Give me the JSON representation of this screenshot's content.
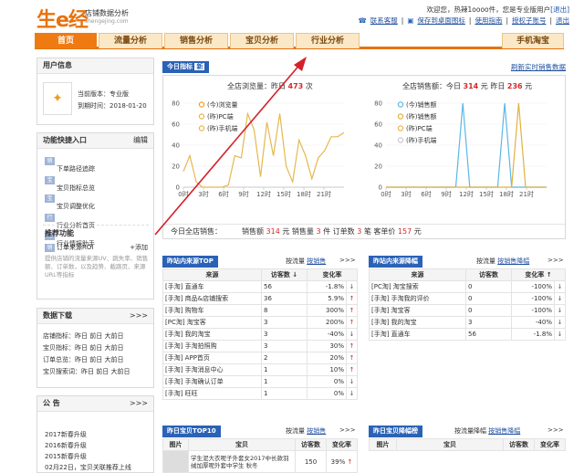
{
  "header": {
    "logo_main": "生e经",
    "logo_sub": "店铺数据分析",
    "logo_url": "shengejing.com",
    "greeting": "欢迎您，热辣1oooo件，您是专业版用户",
    "logout": "[退出]",
    "links": [
      "联系客服",
      "保存到桌面图标",
      "使用指南",
      "授权子账号",
      "退出"
    ]
  },
  "nav": {
    "tabs": [
      "首页",
      "流量分析",
      "销售分析",
      "宝贝分析",
      "行业分析",
      "手机淘宝"
    ]
  },
  "user_info": {
    "title": "用户信息",
    "version": "当前版本：专业版",
    "expire": "到期时间：2018-01-20"
  },
  "quick": {
    "title": "功能快捷入口",
    "edit": "编辑",
    "items": [
      {
        "tag": "销售",
        "label": "下单路径追踪"
      },
      {
        "tag": "宝贝",
        "label": "宝贝指标总览"
      },
      {
        "tag": "宝贝",
        "label": "宝贝调整优化"
      },
      {
        "tag": "行业",
        "label": "行业分析首页"
      },
      {
        "tag": "行业",
        "label": "行业情报助手"
      }
    ],
    "rec_title": "推荐功能",
    "rec_item": "订单来源ROI",
    "rec_add": "+添加",
    "rec_desc": "提供店铺的流量来源UV、跳失率、销售额、订单数，以及趋势、截路页、来源URL等指标"
  },
  "download": {
    "title": "数据下载",
    "more": ">>>",
    "rows": [
      "店铺指标：昨日 前日 大前日",
      "宝贝指标：昨日 前日 大前日",
      "订单总览：昨日 前日 大前日",
      "宝贝搜索词：昨日 前日 大前日"
    ]
  },
  "notice": {
    "title": "公 告",
    "more": ">>>",
    "items": [
      "2017新春升级",
      "2016新春升级",
      "2015新春升级",
      "02月22日，宝贝关联推荐上线"
    ]
  },
  "today": {
    "tag": "今日指标",
    "tag2": "新",
    "refresh": "刷新实时销售数据",
    "traffic_label": "全店浏览量：昨日",
    "traffic_val": "473",
    "traffic_unit": "次",
    "sales_label": "全店销售额：今日",
    "sales_today": "314",
    "sales_mid": "元  昨日",
    "sales_y": "236",
    "sales_unit": "元",
    "footer": {
      "label": "今日全店销售：",
      "items": [
        "销售额 ",
        "314",
        " 元  销售量 ",
        "3",
        " 件  订单数 ",
        "3",
        " 笔  客单价 ",
        "157",
        " 元"
      ]
    }
  },
  "chart_data": [
    {
      "type": "line",
      "legend": [
        "(今)浏览量",
        "(昨)PC端",
        "(昨)手机端"
      ],
      "x": [
        "0时",
        "3时",
        "6时",
        "9时",
        "12时",
        "15时",
        "18时",
        "21时"
      ],
      "yticks": [
        "0",
        "20",
        "40",
        "60",
        "80"
      ],
      "ylim": [
        0,
        80
      ],
      "series": [
        {
          "name": "(今)浏览量",
          "values": []
        },
        {
          "name": "(昨)手机端",
          "values": [
            15,
            30,
            5,
            0,
            0,
            0,
            0,
            2,
            30,
            28,
            70,
            55,
            10,
            62,
            30,
            70,
            20,
            5,
            45,
            30,
            8,
            28,
            35,
            48,
            48,
            52
          ]
        }
      ],
      "colors": [
        "#f0a020",
        "#e6b84f"
      ]
    },
    {
      "type": "line",
      "legend": [
        "(今)销售额",
        "(昨)销售额",
        "(昨)PC端",
        "(昨)手机端"
      ],
      "x": [
        "0时",
        "3时",
        "6时",
        "9时",
        "12时",
        "15时",
        "18时",
        "21时"
      ],
      "yticks": [
        "0",
        "20",
        "40",
        "60",
        "80"
      ],
      "ylim": [
        0,
        80
      ],
      "series": [
        {
          "name": "(今)销售额",
          "values": [
            0,
            0,
            0,
            0,
            0,
            0,
            0,
            0,
            0,
            0,
            0,
            80,
            0,
            0,
            0,
            0,
            0,
            80,
            0,
            0,
            0,
            0,
            0,
            0
          ]
        },
        {
          "name": "(昨)销售额",
          "values": [
            0,
            0,
            0,
            0,
            0,
            0,
            0,
            0,
            0,
            0,
            0,
            0,
            0,
            0,
            0,
            0,
            0,
            0,
            0,
            80,
            0,
            0,
            0,
            0
          ]
        }
      ],
      "colors": [
        "#5bb7e6",
        "#e2b13e"
      ]
    }
  ],
  "src_top": {
    "tag": "昨站内来源TOP",
    "sort_a": "按流量",
    "sort_b": "按销售",
    "more": ">>>",
    "headers": [
      "来源",
      "访客数 ↓",
      "变化率"
    ],
    "rows": [
      [
        "[手淘] 直通车",
        "56",
        "-1.8%",
        "↓"
      ],
      [
        "[手淘] 商品&店铺搜索",
        "36",
        "5.9%",
        "↑"
      ],
      [
        "[手淘] 购物车",
        "8",
        "300%",
        "↑"
      ],
      [
        "[PC淘] 淘宝客",
        "3",
        "200%",
        "↑"
      ],
      [
        "[手淘] 我的淘宝",
        "3",
        "-40%",
        "↓"
      ],
      [
        "[手淘] 手淘拍照购",
        "3",
        "30%",
        "↑"
      ],
      [
        "[手淘] APP首页",
        "2",
        "20%",
        "↑"
      ],
      [
        "[手淘] 手淘消息中心",
        "1",
        "10%",
        "↑"
      ],
      [
        "[手淘] 手淘确认订单",
        "1",
        "0%",
        "↓"
      ],
      [
        "[手淘] 旺旺",
        "1",
        "0%",
        "↓"
      ]
    ]
  },
  "src_drop": {
    "tag": "昨站内来源降幅",
    "sort_a": "按流量",
    "sort_b": "按销售降幅",
    "more": ">>>",
    "headers": [
      "来源",
      "访客数",
      "变化率 ↑"
    ],
    "rows": [
      [
        "[PC淘] 淘宝搜索",
        "0",
        "-100%",
        "↓"
      ],
      [
        "[手淘] 手淘我的评价",
        "0",
        "-100%",
        "↓"
      ],
      [
        "[手淘] 淘宝客",
        "0",
        "-100%",
        "↓"
      ],
      [
        "[手淘] 我的淘宝",
        "3",
        "-40%",
        "↓"
      ],
      [
        "[手淘] 直通车",
        "56",
        "-1.8%",
        "↓"
      ]
    ]
  },
  "item_top": {
    "tag": "昨日宝贝TOP10",
    "sort_a": "按流量",
    "sort_b": "按销售",
    "more": ">>>",
    "headers": [
      "图片",
      "宝贝",
      "访客数",
      "变化率"
    ],
    "row": [
      "学生泥大衣呢子外套女2017中长款羽绒加厚呢外套中学生 秋冬",
      "150",
      "39%"
    ]
  },
  "item_drop": {
    "tag": "昨日宝贝降幅榜",
    "sort_a": "按流量降幅",
    "sort_b": "按销售降幅",
    "more": ">>>",
    "headers": [
      "图片",
      "宝贝",
      "访客数",
      "变化率"
    ]
  }
}
